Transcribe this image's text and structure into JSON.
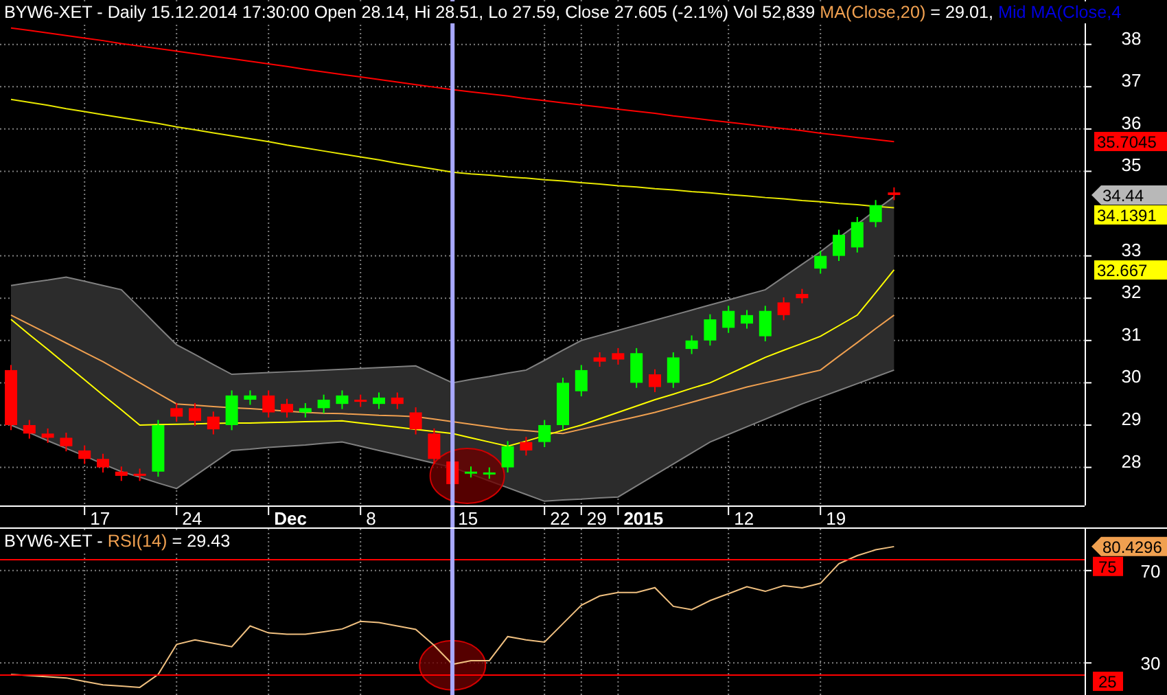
{
  "price_panel": {
    "legend": [
      {
        "text": "BYW6-XET - Daily 15.12.2014 17:30:00 Open 28.14, Hi 28.51, Lo 27.59, Close 27.605 (-2.1%) Vol 52,839 ",
        "color": "#ffffff"
      },
      {
        "text": "MA(Close,20)",
        "color": "#f0a050"
      },
      {
        "text": " = 29.01, ",
        "color": "#ffffff"
      },
      {
        "text": "Mid MA(Close,4",
        "color": "#0000e0"
      }
    ],
    "y_axis_labels": [
      "38",
      "37",
      "36",
      "35",
      "33",
      "32",
      "31",
      "30",
      "29",
      "28"
    ],
    "x_axis_labels": [
      {
        "text": "17",
        "major": false
      },
      {
        "text": "24",
        "major": false
      },
      {
        "text": "Dec",
        "major": true
      },
      {
        "text": "8",
        "major": false
      },
      {
        "text": "15",
        "major": false
      },
      {
        "text": "22",
        "major": false
      },
      {
        "text": "29",
        "major": false
      },
      {
        "text": "2015",
        "major": true
      },
      {
        "text": "12",
        "major": false
      },
      {
        "text": "19",
        "major": false
      }
    ],
    "value_labels": [
      {
        "text": "35.7045",
        "color": "#ff0000",
        "kind": "box"
      },
      {
        "text": "34.44",
        "color": "#b8b8b8",
        "kind": "arrow"
      },
      {
        "text": "34.1391",
        "color": "#ffff00",
        "kind": "box"
      },
      {
        "text": "32.667",
        "color": "#ffff00",
        "kind": "box"
      }
    ]
  },
  "rsi_panel": {
    "title_prefix": "BYW6-XET - ",
    "title_suffix": " = 29.43",
    "value_labels": [
      {
        "text": "80.4296",
        "color": "#f0a050",
        "kind": "arrow"
      }
    ],
    "chart_data": {
      "type": "line",
      "categories": [
        null,
        null,
        null,
        null,
        null,
        null,
        null,
        null,
        null,
        null,
        null,
        null,
        null,
        null,
        null,
        null,
        null,
        null,
        null,
        null,
        null,
        null,
        null,
        null,
        null,
        null,
        null,
        null,
        null,
        null,
        null,
        null,
        null,
        null,
        null,
        null,
        null,
        null,
        null,
        null,
        null,
        null,
        null,
        null,
        null,
        null,
        null,
        null,
        null
      ],
      "ylim": [
        16.1,
        88.1
      ],
      "yticks": [
        30,
        70
      ],
      "grid": true,
      "series": [
        {
          "name": "RSI(14)",
          "color": "#f0c080",
          "values": [
            25,
            24.5,
            24,
            23.5,
            22,
            20.5,
            20,
            19.4,
            25,
            38,
            40,
            38.5,
            37,
            46,
            43,
            42.4,
            42.4,
            43.5,
            44.7,
            48,
            47.5,
            46,
            44.5,
            37.6,
            29.4,
            31,
            31,
            41.4,
            40,
            39,
            47,
            55,
            59,
            60.5,
            60.5,
            62.6,
            54.5,
            53.1,
            57,
            60,
            63,
            61,
            63.5,
            62.5,
            64.5,
            73,
            76.5,
            79,
            80.4
          ]
        }
      ]
    },
    "levels": [
      {
        "label": "75",
        "color": "#ff0000"
      },
      {
        "label": "25",
        "color": "#ff0000"
      }
    ]
  }
}
